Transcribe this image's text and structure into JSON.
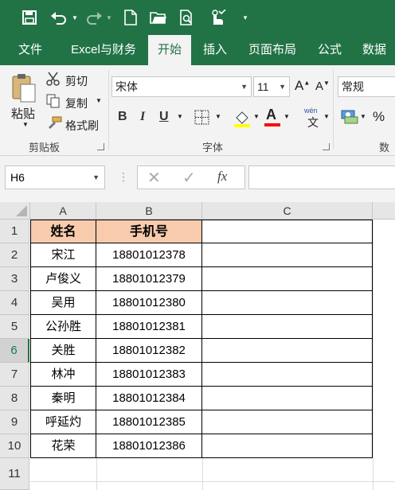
{
  "qat": {
    "icons": [
      "save-icon",
      "undo-icon",
      "redo-icon",
      "new-file-icon",
      "open-folder-icon",
      "print-preview-icon",
      "touch-mode-icon",
      "customize-qat-icon"
    ]
  },
  "tabs": [
    "文件",
    "Excel与财务",
    "开始",
    "插入",
    "页面布局",
    "公式",
    "数据"
  ],
  "active_tab": "开始",
  "ribbon": {
    "clipboard": {
      "paste": "粘贴",
      "cut": "剪切",
      "copy": "复制",
      "format_painter": "格式刷",
      "label": "剪贴板"
    },
    "font": {
      "font_name": "宋体",
      "font_size": "11",
      "bold": "B",
      "italic": "I",
      "underline": "U",
      "label": "字体",
      "fill_color": "#ffff00",
      "font_color": "#ff0000",
      "pinyin": "wén"
    },
    "number": {
      "format": "常规",
      "percent": "%",
      "label": "数字"
    }
  },
  "formula_bar": {
    "name_box": "H6",
    "fx": "fx",
    "formula": ""
  },
  "sheet": {
    "columns": [
      "A",
      "B",
      "C"
    ],
    "rows": [
      "1",
      "2",
      "3",
      "4",
      "5",
      "6",
      "7",
      "8",
      "9",
      "10",
      "11"
    ],
    "selected_row": "6",
    "header": [
      "姓名",
      "手机号"
    ],
    "data": [
      [
        "宋江",
        "18801012378"
      ],
      [
        "卢俊义",
        "18801012379"
      ],
      [
        "吴用",
        "18801012380"
      ],
      [
        "公孙胜",
        "18801012381"
      ],
      [
        "关胜",
        "18801012382"
      ],
      [
        "林冲",
        "18801012383"
      ],
      [
        "秦明",
        "18801012384"
      ],
      [
        "呼延灼",
        "18801012385"
      ],
      [
        "花荣",
        "18801012386"
      ]
    ],
    "header_fill": "#f8cbad"
  }
}
